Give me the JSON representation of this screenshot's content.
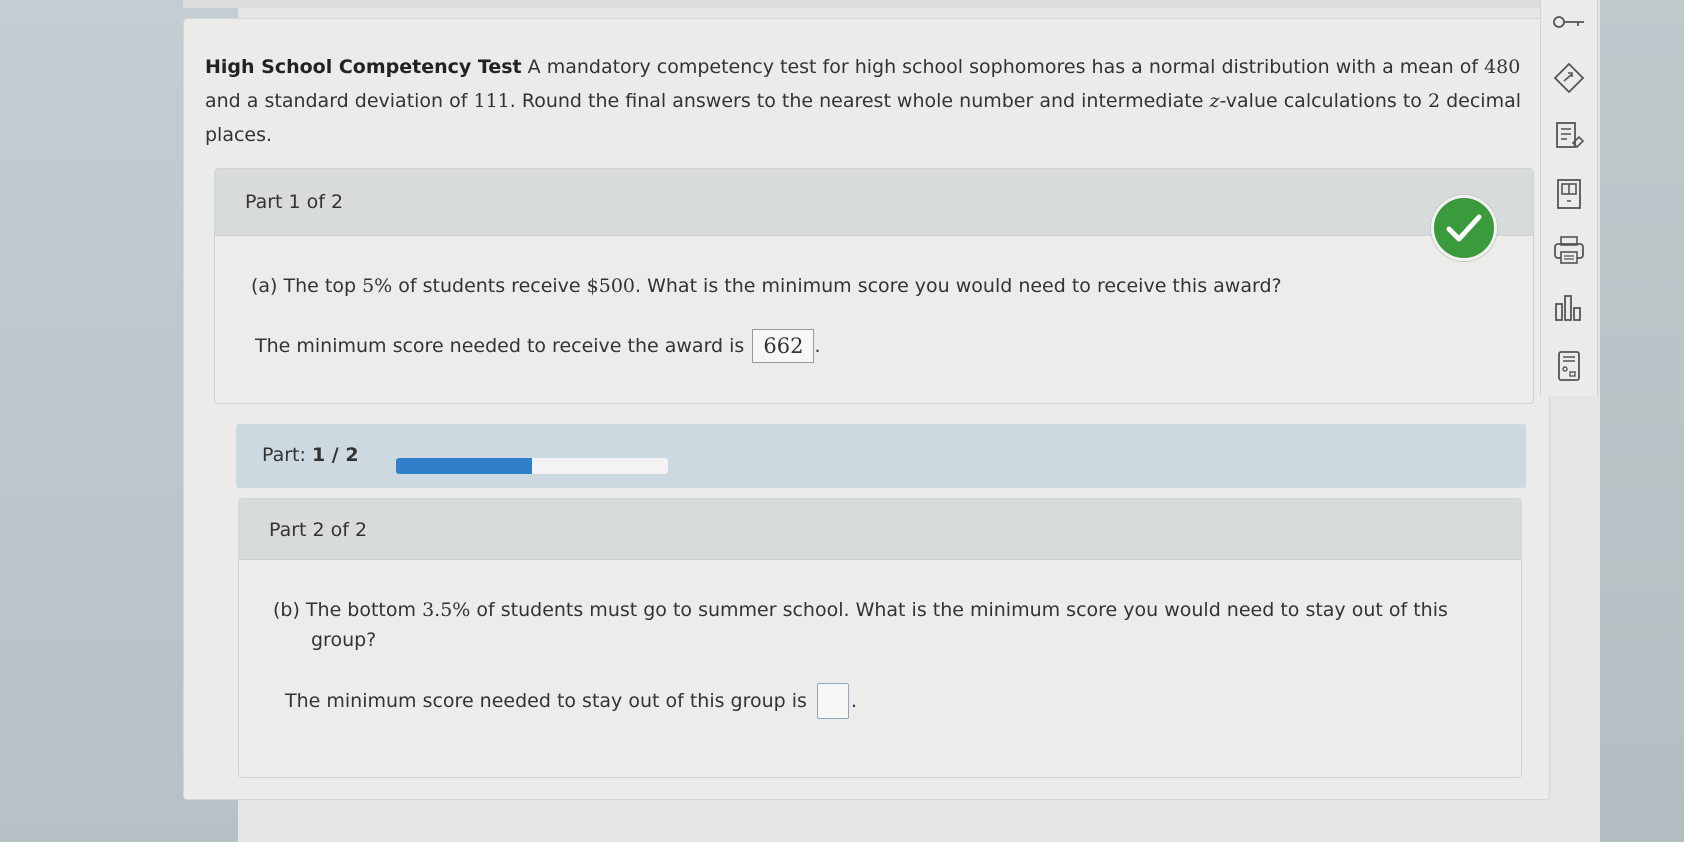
{
  "intro": {
    "title": "High School Competency Test",
    "text_a": " A mandatory competency test for high school sophomores has a normal distribution with a mean of ",
    "mean": "480",
    "text_b": " and a standard deviation of ",
    "sd": "111",
    "text_c": ". Round the final answers to the nearest whole number and intermediate ",
    "zvar": "z",
    "text_d": "-value calculations to ",
    "decimals": "2",
    "text_e": " decimal places."
  },
  "part1": {
    "title": "Part 1 of 2",
    "question_prefix": "(a) The top ",
    "pct": "5%",
    "question_mid": " of students receive ",
    "amount": "$500",
    "question_suffix": ". What is the minimum score you would need to receive this award?",
    "answer_label": "The minimum score needed to receive the award is",
    "answer_value": "662",
    "answer_end": ".",
    "status_color": "#3a9a3c"
  },
  "progress": {
    "label": "Part:",
    "value": "1 / 2",
    "fraction": 0.5,
    "color": "#2f7fc9"
  },
  "part2": {
    "title": "Part 2 of 2",
    "question_prefix": "(b) The bottom ",
    "pct": "3.5%",
    "question_suffix_1": " of students must go to summer school. What is the minimum score you would need to stay out of this",
    "question_suffix_2": "group?",
    "answer_label": "The minimum score needed to stay out of this group is",
    "answer_end": "."
  },
  "toolbar": {
    "icons": [
      "key-icon",
      "tag-icon",
      "notes-icon",
      "ebook-icon",
      "print-icon",
      "stats-icon",
      "calculator-icon"
    ]
  }
}
